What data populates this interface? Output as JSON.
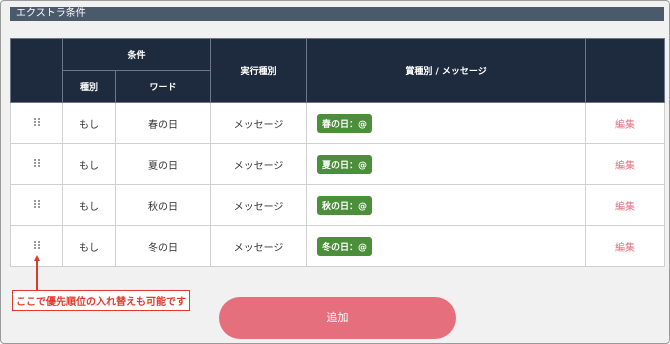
{
  "section": {
    "title": "エクストラ条件"
  },
  "table": {
    "headers": {
      "condition": "条件",
      "type": "種別",
      "word": "ワード",
      "exec_type": "実行種別",
      "prize_message": "賞種別 / メッセージ"
    },
    "rows": [
      {
        "type": "もし",
        "word": "春の日",
        "exec": "メッセージ",
        "badge": "春の日：@",
        "edit": "編集"
      },
      {
        "type": "もし",
        "word": "夏の日",
        "exec": "メッセージ",
        "badge": "夏の日：@",
        "edit": "編集"
      },
      {
        "type": "もし",
        "word": "秋の日",
        "exec": "メッセージ",
        "badge": "秋の日：@",
        "edit": "編集"
      },
      {
        "type": "もし",
        "word": "冬の日",
        "exec": "メッセージ",
        "badge": "冬の日：@",
        "edit": "編集"
      }
    ]
  },
  "add_button": {
    "label": "追加"
  },
  "annotation": {
    "text": "ここで優先順位の入れ替えも可能です"
  },
  "colors": {
    "header_bg": "#1e2b3e",
    "section_bg": "#4b5a6b",
    "badge_green": "#4b8f3a",
    "edit_pink": "#e07080",
    "button_pink": "#e66f7d",
    "annotation_red": "#e03a2a"
  },
  "icons": {
    "drag_handle": "drag-handle-icon"
  }
}
